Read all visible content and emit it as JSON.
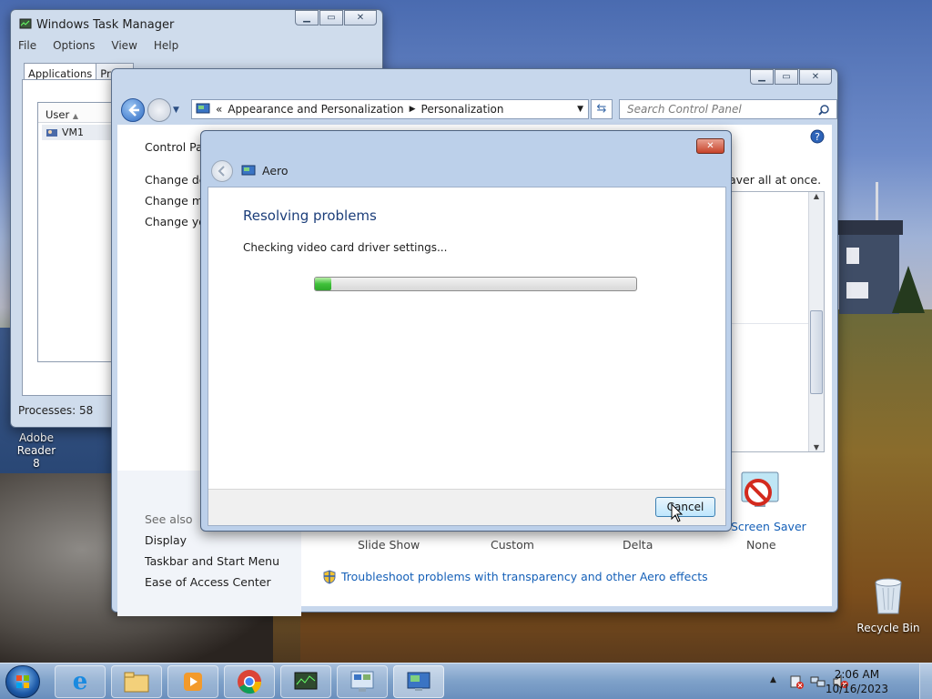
{
  "desktop": {
    "icons": [
      {
        "label": "Adobe Reader\n8"
      },
      {
        "label": "Recycle Bin"
      }
    ]
  },
  "task_manager": {
    "title": "Windows Task Manager",
    "menu": [
      "File",
      "Options",
      "View",
      "Help"
    ],
    "tabs": [
      "Applications",
      "Proce"
    ],
    "column": "User",
    "rows": [
      "VM1"
    ],
    "status": "Processes: 58"
  },
  "control_panel": {
    "breadcrumb_sep": "«",
    "breadcrumb": [
      "Appearance and Personalization",
      "Personalization"
    ],
    "search_placeholder": "Search Control Panel",
    "left_links": [
      "Control Pan",
      "Change des",
      "Change mo",
      "Change you"
    ],
    "see_also_title": "See also",
    "see_also": [
      "Display",
      "Taskbar and Start Menu",
      "Ease of Access Center"
    ],
    "right_fragment": "aver all at once.",
    "bottom_labels": [
      "Slide Show",
      "Custom",
      "Delta",
      "None"
    ],
    "screen_saver_label": "Screen Saver",
    "troubleshoot_link": "Troubleshoot problems with transparency and other Aero effects"
  },
  "dialog": {
    "title": "Aero",
    "heading": "Resolving problems",
    "message": "Checking video card driver settings...",
    "progress_fraction": 0.05,
    "cancel": "Cancel"
  },
  "taskbar": {
    "time": "2:06 AM",
    "date": "10/16/2023"
  }
}
